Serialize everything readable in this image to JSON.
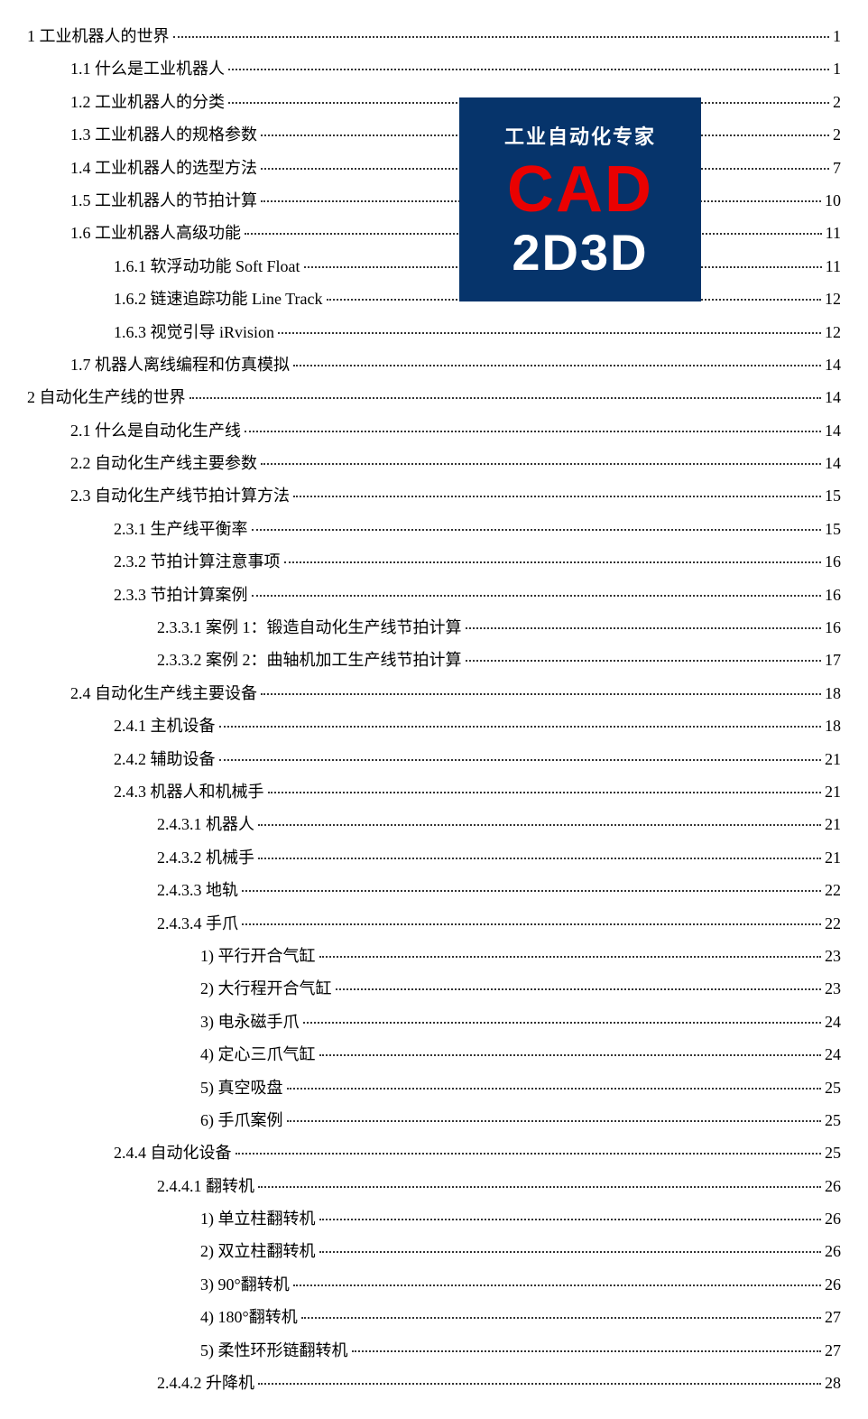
{
  "watermark": {
    "line1": "工业自动化专家",
    "line2": "CAD",
    "line3": "2D3D"
  },
  "toc": [
    {
      "level": 0,
      "label": "1  工业机器人的世界",
      "page": "1"
    },
    {
      "level": 1,
      "label": "1.1  什么是工业机器人",
      "page": "1"
    },
    {
      "level": 1,
      "label": "1.2  工业机器人的分类",
      "page": "2"
    },
    {
      "level": 1,
      "label": "1.3  工业机器人的规格参数",
      "page": "2"
    },
    {
      "level": 1,
      "label": "1.4  工业机器人的选型方法",
      "page": "7"
    },
    {
      "level": 1,
      "label": "1.5  工业机器人的节拍计算",
      "page": "10"
    },
    {
      "level": 1,
      "label": "1.6  工业机器人高级功能",
      "page": "11"
    },
    {
      "level": 2,
      "label": "1.6.1  软浮动功能  Soft Float",
      "page": "11"
    },
    {
      "level": 2,
      "label": "1.6.2  链速追踪功能  Line Track ",
      "page": "12"
    },
    {
      "level": 2,
      "label": "1.6.3  视觉引导  iRvision ",
      "page": "12"
    },
    {
      "level": 1,
      "label": "1.7  机器人离线编程和仿真模拟",
      "page": "14"
    },
    {
      "level": 0,
      "label": "2  自动化生产线的世界",
      "page": "14"
    },
    {
      "level": 1,
      "label": "2.1  什么是自动化生产线",
      "page": "14"
    },
    {
      "level": 1,
      "label": "2.2  自动化生产线主要参数",
      "page": "14"
    },
    {
      "level": 1,
      "label": "2.3  自动化生产线节拍计算方法",
      "page": "15"
    },
    {
      "level": 2,
      "label": "2.3.1  生产线平衡率",
      "page": "15"
    },
    {
      "level": 2,
      "label": "2.3.2  节拍计算注意事项",
      "page": "16"
    },
    {
      "level": 2,
      "label": "2.3.3  节拍计算案例",
      "page": "16"
    },
    {
      "level": 3,
      "label": "2.3.3.1  案例 1：锻造自动化生产线节拍计算",
      "page": "16"
    },
    {
      "level": 3,
      "label": "2.3.3.2  案例 2：曲轴机加工生产线节拍计算",
      "page": "17"
    },
    {
      "level": 1,
      "label": "2.4  自动化生产线主要设备",
      "page": "18"
    },
    {
      "level": 2,
      "label": "2.4.1  主机设备",
      "page": "18"
    },
    {
      "level": 2,
      "label": "2.4.2  辅助设备",
      "page": "21"
    },
    {
      "level": 2,
      "label": "2.4.3  机器人和机械手",
      "page": "21"
    },
    {
      "level": 3,
      "label": "2.4.3.1  机器人",
      "page": "21"
    },
    {
      "level": 3,
      "label": "2.4.3.2  机械手",
      "page": "21"
    },
    {
      "level": 3,
      "label": "2.4.3.3  地轨",
      "page": "22"
    },
    {
      "level": 3,
      "label": "2.4.3.4  手爪",
      "page": "22"
    },
    {
      "level": 4,
      "label": "1)  平行开合气缸 ",
      "page": "23"
    },
    {
      "level": 4,
      "label": "2)  大行程开合气缸 ",
      "page": "23"
    },
    {
      "level": 4,
      "label": "3)  电永磁手爪 ",
      "page": "24"
    },
    {
      "level": 4,
      "label": "4)  定心三爪气缸 ",
      "page": "24"
    },
    {
      "level": 4,
      "label": "5)  真空吸盘 ",
      "page": "25"
    },
    {
      "level": 4,
      "label": "6)  手爪案例 ",
      "page": "25"
    },
    {
      "level": 2,
      "label": "2.4.4  自动化设备",
      "page": "25"
    },
    {
      "level": 3,
      "label": "2.4.4.1  翻转机",
      "page": "26"
    },
    {
      "level": 4,
      "label": "1)  单立柱翻转机 ",
      "page": "26"
    },
    {
      "level": 4,
      "label": "2)  双立柱翻转机 ",
      "page": "26"
    },
    {
      "level": 4,
      "label": "3) 90°翻转机 ",
      "page": "26"
    },
    {
      "level": 4,
      "label": "4) 180°翻转机 ",
      "page": "27"
    },
    {
      "level": 4,
      "label": "5)  柔性环形链翻转机 ",
      "page": "27"
    },
    {
      "level": 3,
      "label": "2.4.4.2  升降机",
      "page": "28"
    }
  ]
}
